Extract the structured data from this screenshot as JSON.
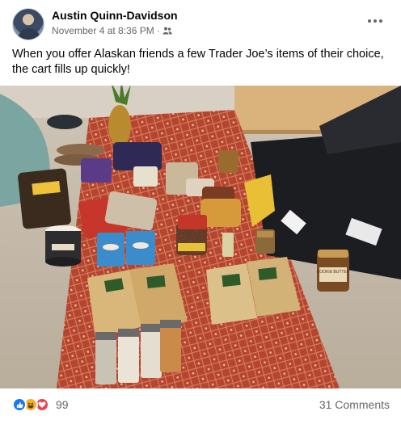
{
  "post": {
    "author": "Austin Quinn-Davidson",
    "timestamp": "November 4 at 8:36 PM",
    "separator": "·",
    "audience_icon": "friends-icon",
    "caption": "When you offer Alaskan friends a few Trader Joe’s items of their choice, the cart fills up quickly!",
    "photo": {
      "jar_labels": [
        "COOKIE BUTTER"
      ]
    }
  },
  "footer": {
    "reaction_icons": [
      "like-icon",
      "haha-icon",
      "love-icon"
    ],
    "reaction_count": "99",
    "comments_label": "31 Comments"
  },
  "colors": {
    "text_primary": "#050505",
    "text_secondary": "#65676b",
    "like": "#1877f2",
    "haha": "#f7b125",
    "love": "#f33e58"
  }
}
